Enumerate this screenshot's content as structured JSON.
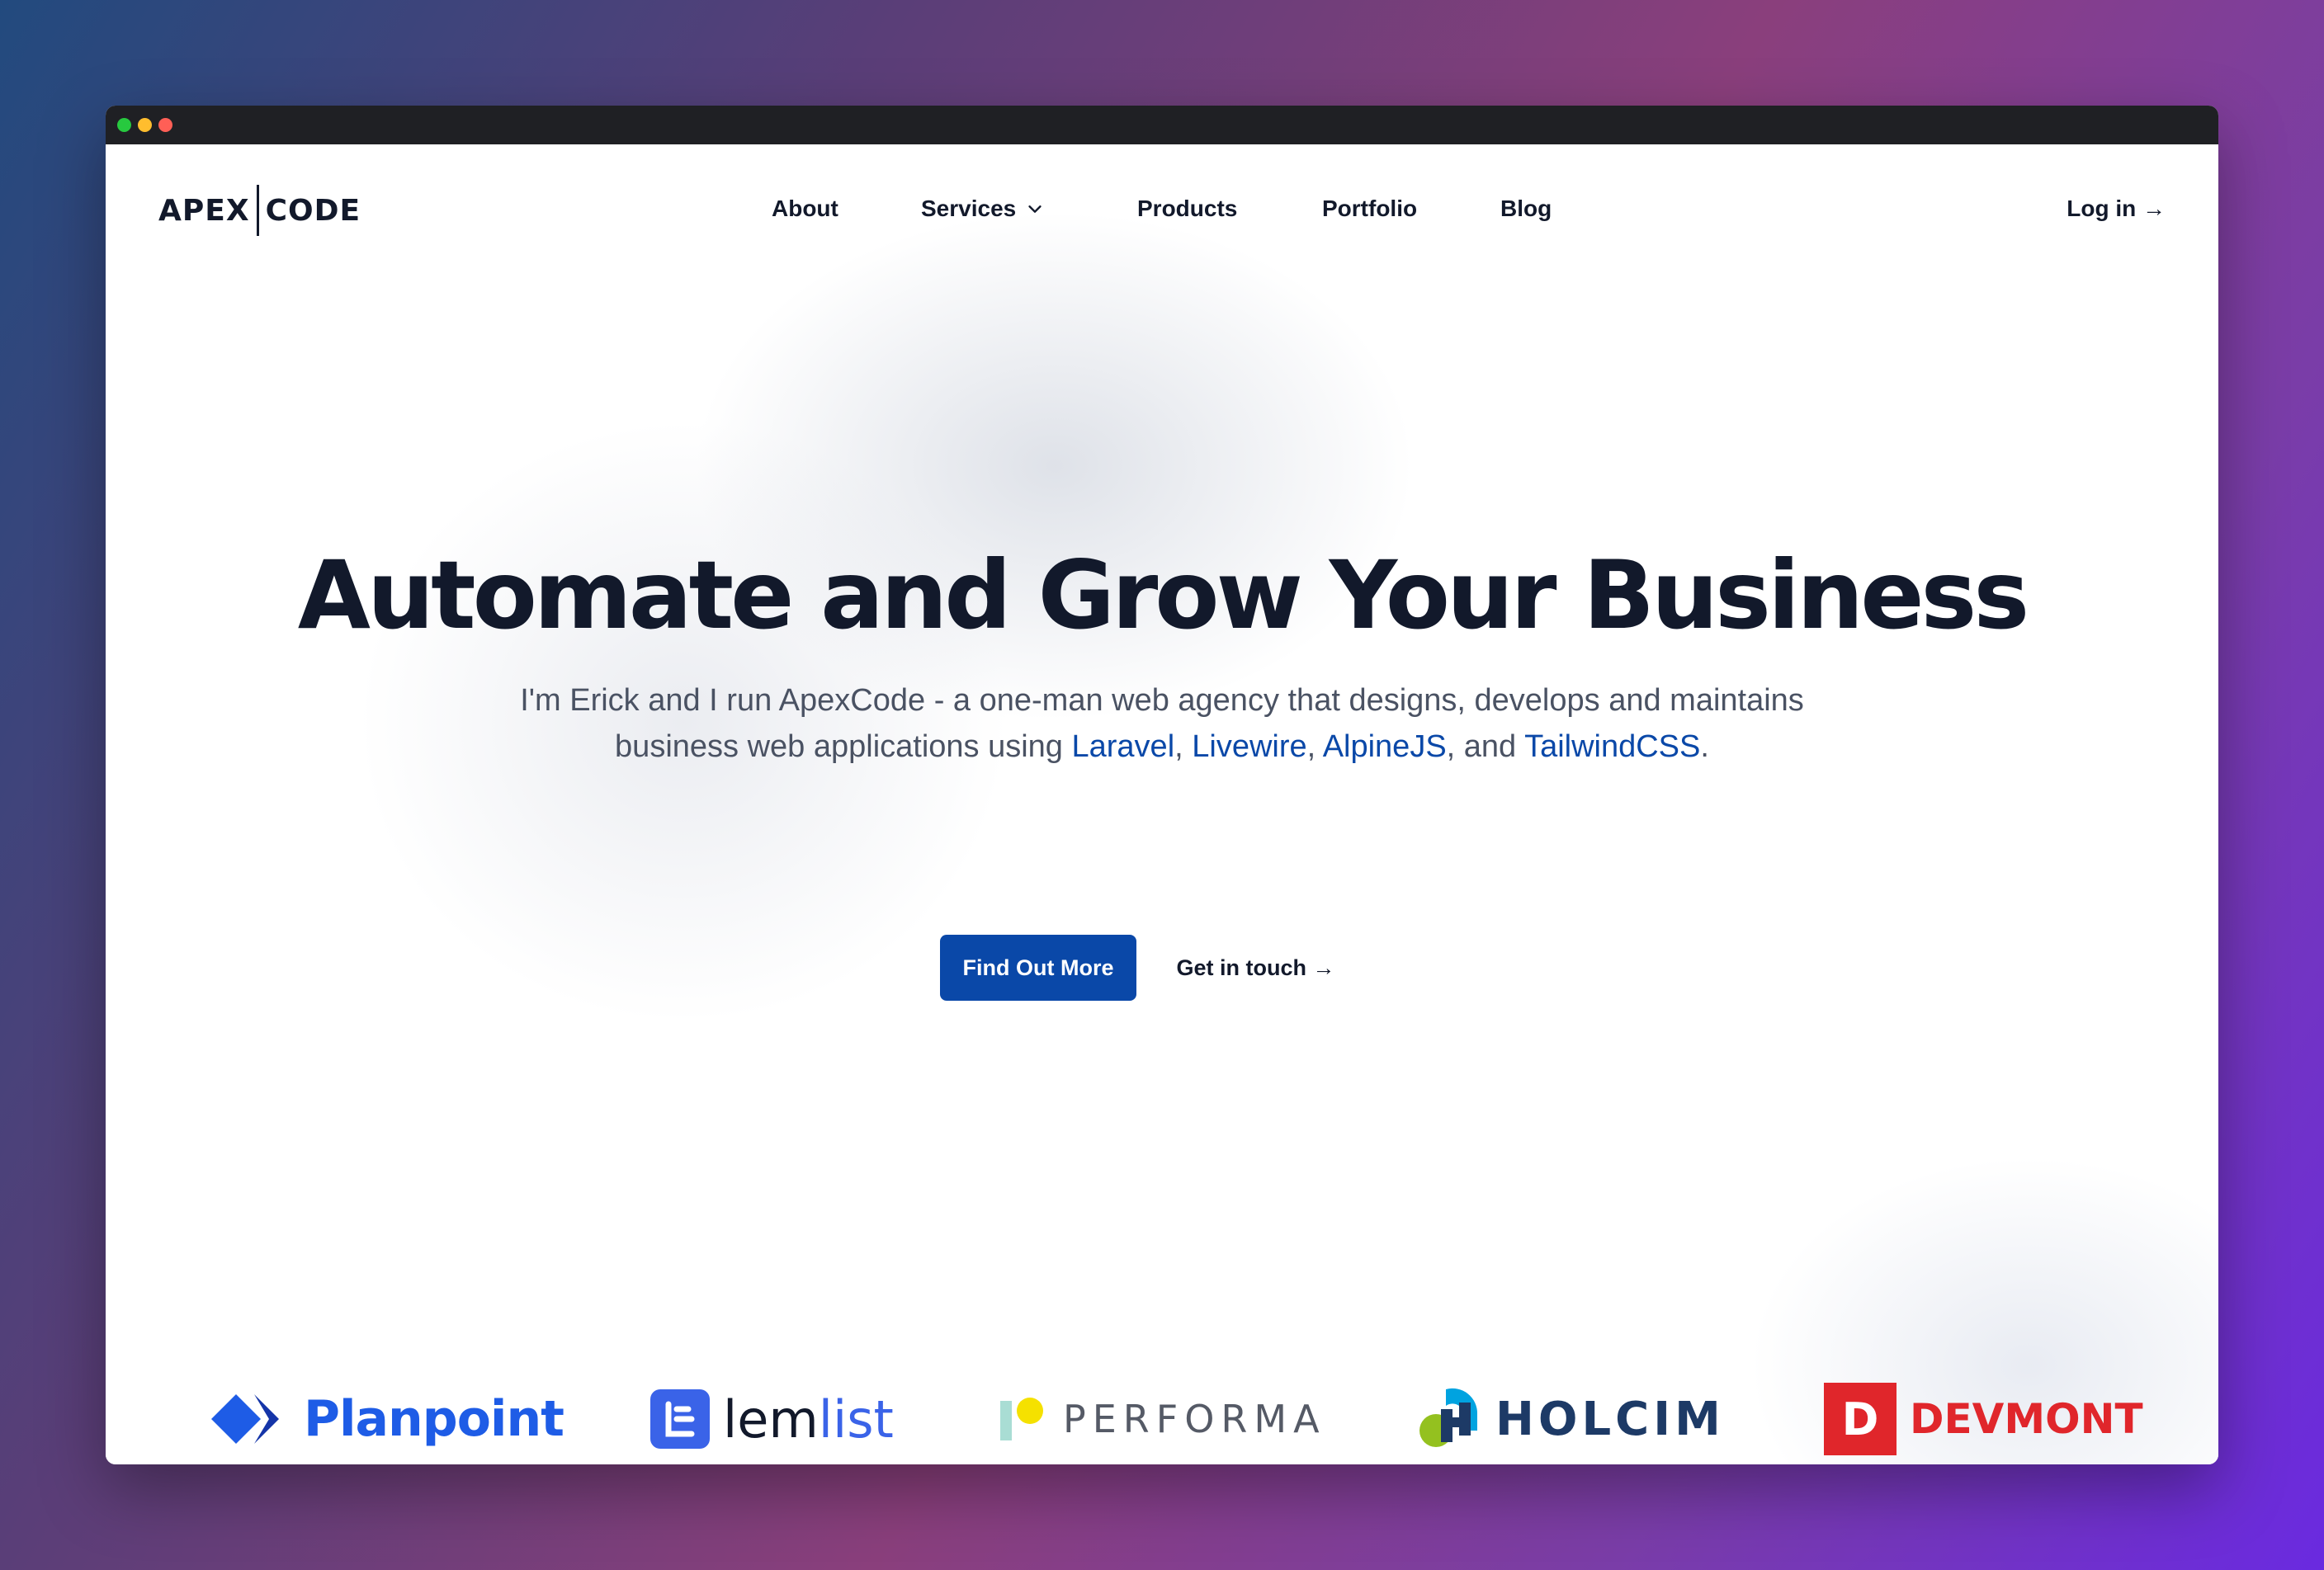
{
  "window": {
    "traffic_lights": [
      {
        "name": "green",
        "color": "#27c93f"
      },
      {
        "name": "yellow",
        "color": "#ffbd2e"
      },
      {
        "name": "red",
        "color": "#ff5f56"
      }
    ]
  },
  "nav": {
    "logo_left": "APEX",
    "logo_right": "CODE",
    "items": [
      {
        "label": "About"
      },
      {
        "label": "Services",
        "has_dropdown": true,
        "icon": "chevron-down-icon"
      },
      {
        "label": "Products"
      },
      {
        "label": "Portfolio"
      },
      {
        "label": "Blog"
      }
    ],
    "login_label": "Log in →"
  },
  "hero": {
    "title": "Automate and Grow Your Business",
    "subtitle_part1": "I'm Erick and I run ApexCode - a one-man web agency that designs, develops and maintains business web applications using ",
    "links": [
      "Laravel",
      "Livewire",
      "AlpineJS",
      "TailwindCSS"
    ],
    "sep1": ", ",
    "sep2": ", ",
    "sep3": ", and ",
    "end": ".",
    "primary_cta": "Find Out More",
    "secondary_cta": "Get in touch →"
  },
  "clients": {
    "planpoint": "Planpoint",
    "lemlist_a": "lem",
    "lemlist_b": "list",
    "performa": "PERFORMA",
    "holcim": "HOLCIM",
    "devmont_mark": "D",
    "devmont": "DEVMONT"
  },
  "colors": {
    "accent": "#0a48a8",
    "text_dark": "#12192b",
    "text_muted": "#4a5263"
  }
}
